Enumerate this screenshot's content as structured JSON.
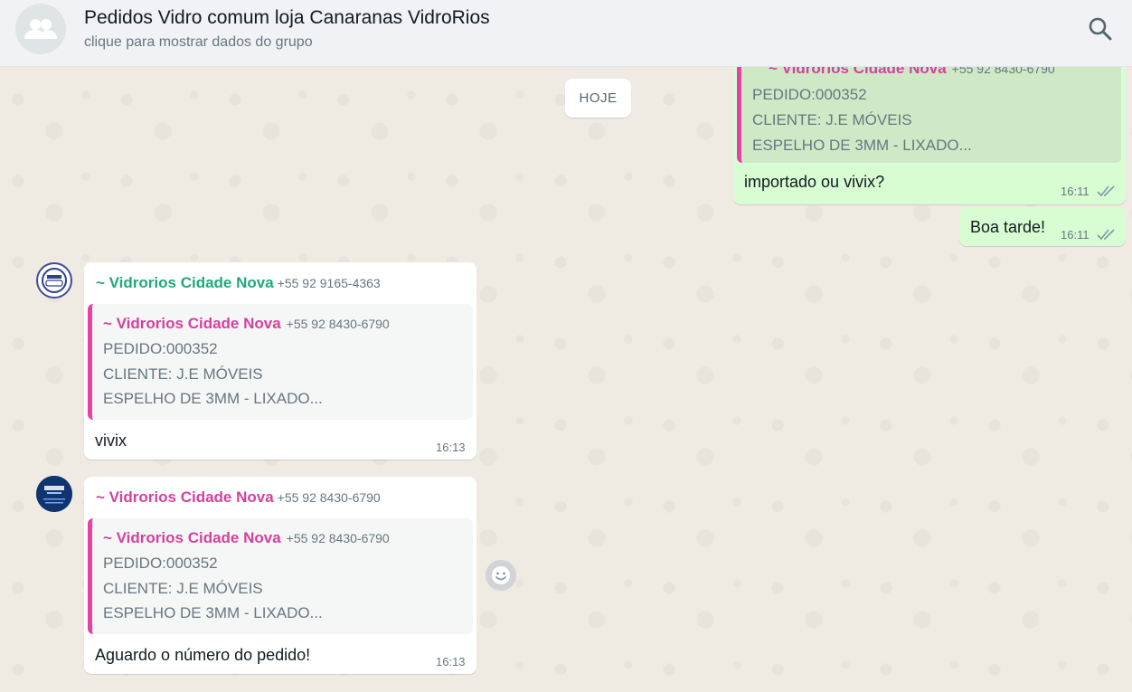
{
  "header": {
    "title": "Pedidos Vidro comum loja Canaranas VidroRios",
    "subtitle": "clique para mostrar dados do grupo",
    "avatar_icon": "group-icon",
    "search_icon": "search-icon"
  },
  "date_chip": "HOJE",
  "colors": {
    "accent_pink": "#d6409f",
    "accent_green": "#1fa97c",
    "outgoing_bubble": "#d9fdd3",
    "incoming_bubble": "#ffffff"
  },
  "messages": [
    {
      "direction": "out",
      "quote": {
        "sender": "~ Vidrorios Cidade Nova",
        "phone": "+55 92 8430-6790",
        "lines": [
          "PEDIDO:000352",
          "CLIENTE: J.E MÓVEIS",
          "ESPELHO DE 3MM - LIXADO..."
        ]
      },
      "text": "importado ou vivix?",
      "time": "16:11",
      "status": "double-check-icon"
    },
    {
      "direction": "out",
      "text": "Boa tarde!",
      "time": "16:11",
      "status": "double-check-icon"
    },
    {
      "direction": "in",
      "sender": "~ Vidrorios Cidade Nova",
      "phone": "+55 92 9165-4363",
      "quote": {
        "sender": "~ Vidrorios Cidade Nova",
        "phone": "+55 92 8430-6790",
        "lines": [
          "PEDIDO:000352",
          "CLIENTE: J.E MÓVEIS",
          "ESPELHO DE 3MM - LIXADO..."
        ]
      },
      "text": "vivix",
      "time": "16:13"
    },
    {
      "direction": "in",
      "sender": "~ Vidrorios Cidade Nova",
      "phone": "+55 92 8430-6790",
      "quote": {
        "sender": "~ Vidrorios Cidade Nova",
        "phone": "+55 92 8430-6790",
        "lines": [
          "PEDIDO:000352",
          "CLIENTE: J.E MÓVEIS",
          "ESPELHO DE 3MM - LIXADO..."
        ]
      },
      "text": "Aguardo o número do pedido!",
      "time": "16:13"
    }
  ],
  "emoji_button_icon": "smiley-icon"
}
